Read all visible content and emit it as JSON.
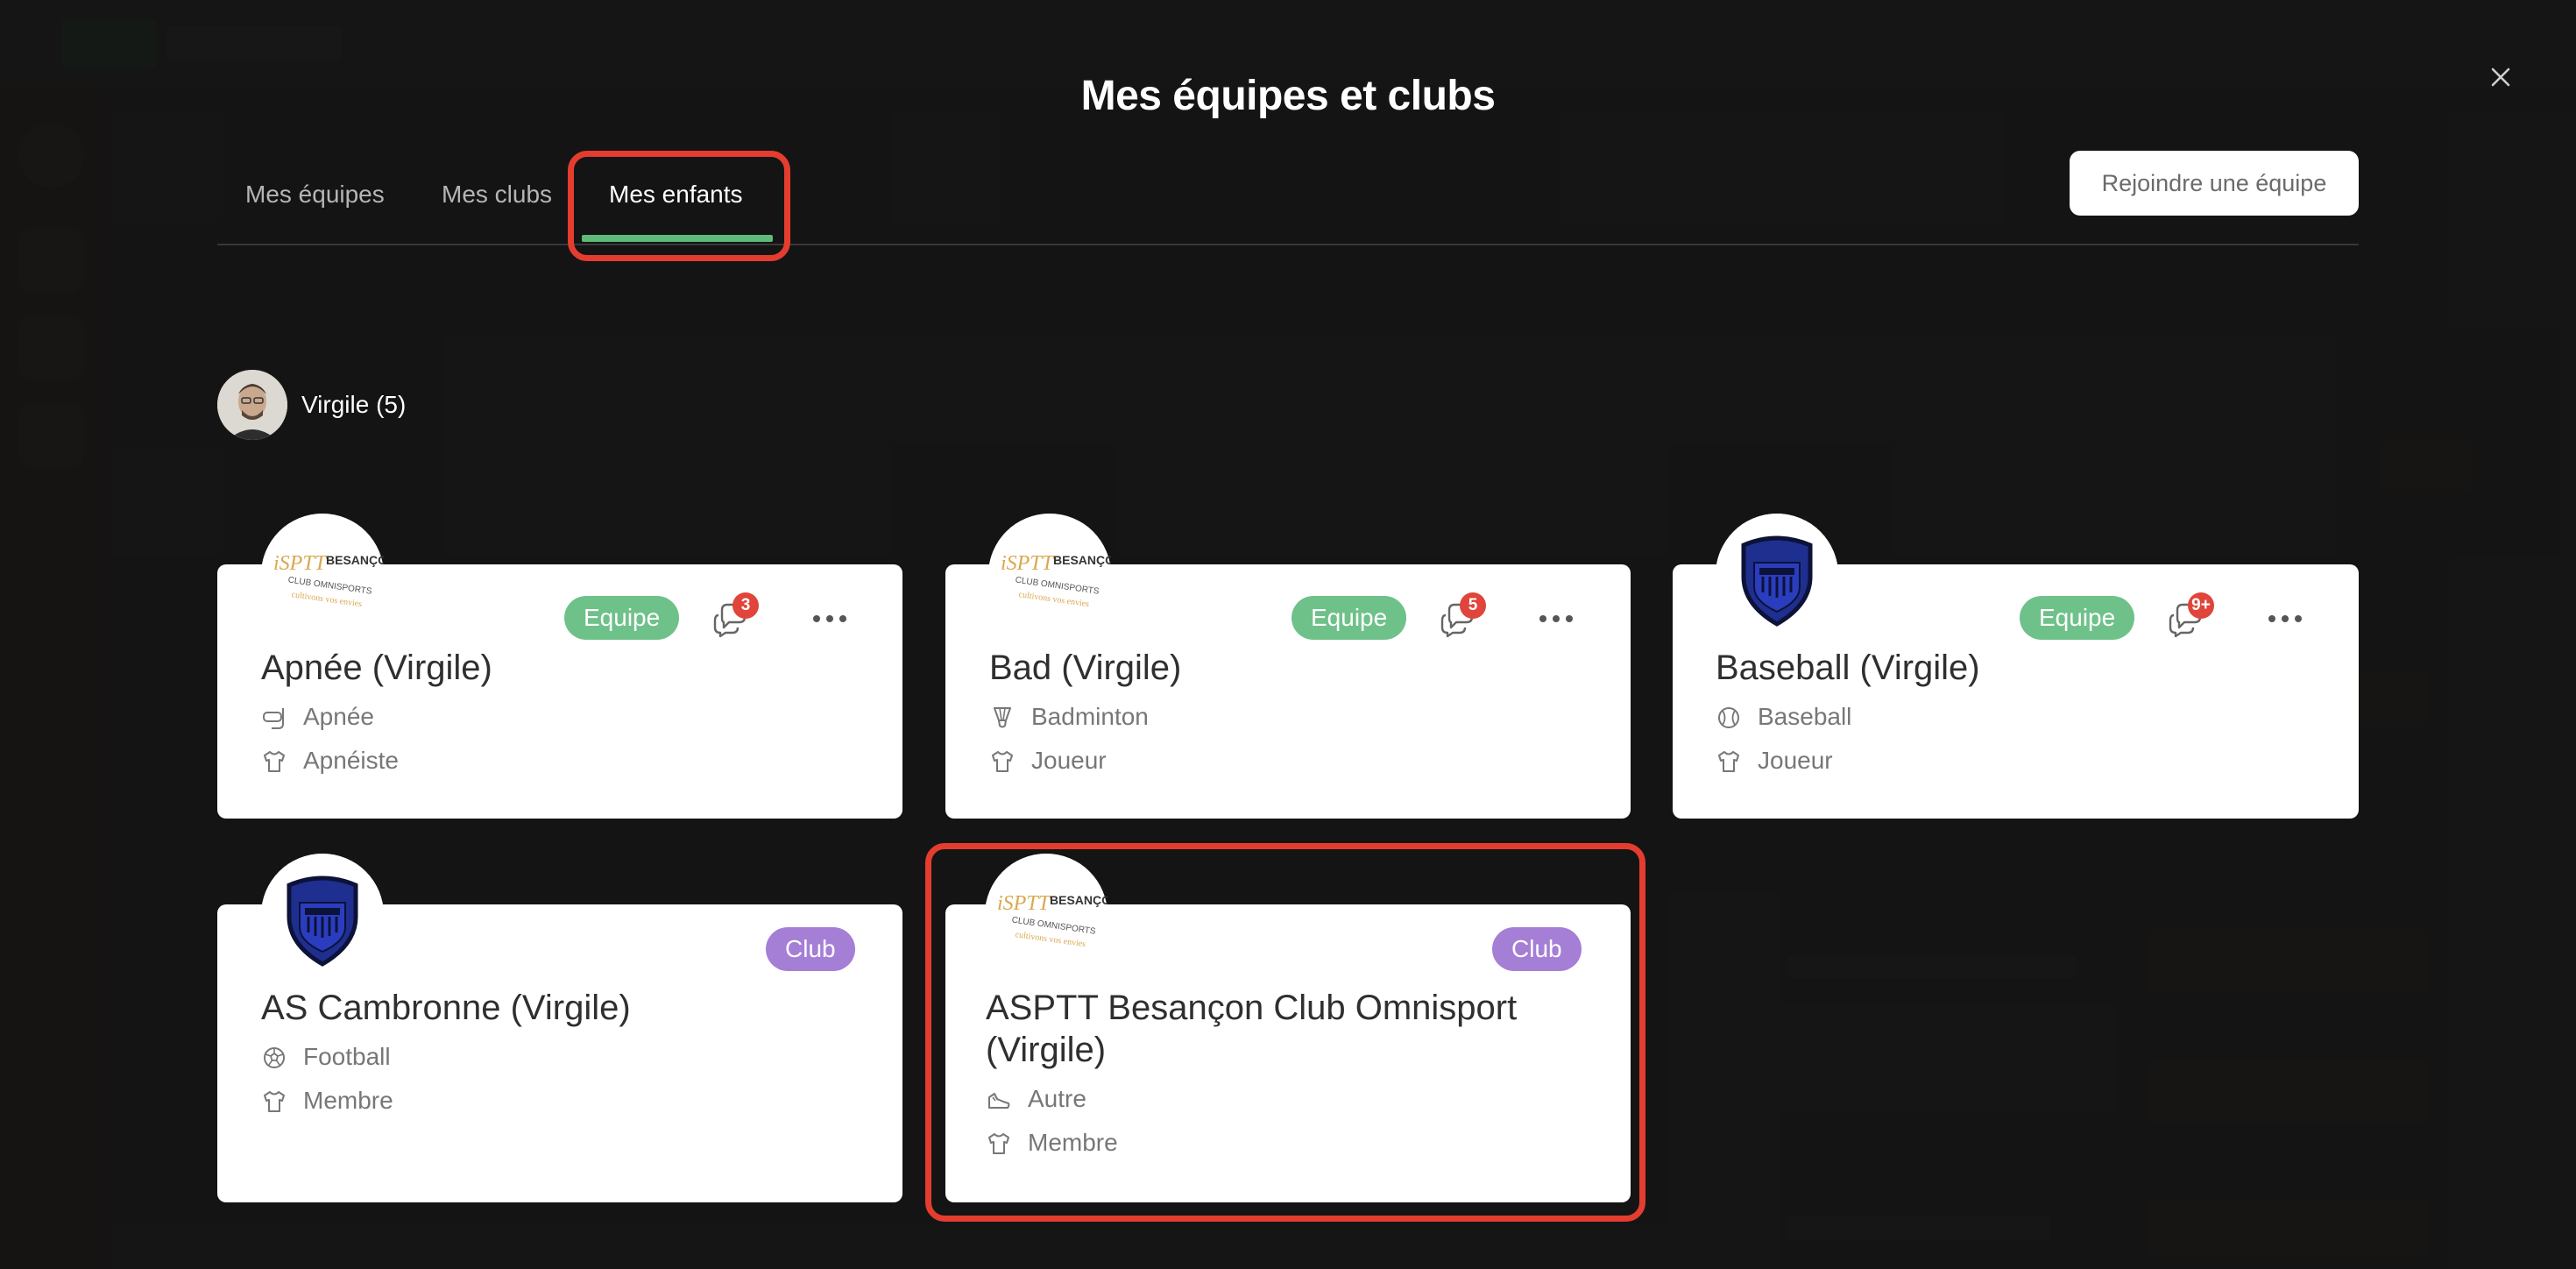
{
  "modal": {
    "title": "Mes équipes et clubs",
    "tabs": [
      {
        "label": "Mes équipes",
        "active": false
      },
      {
        "label": "Mes clubs",
        "active": false
      },
      {
        "label": "Mes enfants",
        "active": true
      }
    ],
    "join_button": "Rejoindre une équipe",
    "child": {
      "name": "Virgile (5)"
    },
    "cards": [
      {
        "title": "Apnée (Virgile)",
        "badge": "Equipe",
        "messages": "3",
        "sport": "Apnée",
        "role": "Apnéiste",
        "logo": "asptt-logo"
      },
      {
        "title": "Bad (Virgile)",
        "badge": "Equipe",
        "messages": "5",
        "sport": "Badminton",
        "role": "Joueur",
        "logo": "asptt-logo"
      },
      {
        "title": "Baseball (Virgile)",
        "badge": "Equipe",
        "messages": "9+",
        "sport": "Baseball",
        "role": "Joueur",
        "logo": "shield-logo"
      },
      {
        "title": "AS Cambronne (Virgile)",
        "badge": "Club",
        "sport": "Football",
        "role": "Membre",
        "logo": "shield-logo"
      },
      {
        "title": "ASPTT Besançon Club Omnisport (Virgile)",
        "badge": "Club",
        "sport": "Autre",
        "role": "Membre",
        "logo": "asptt-logo"
      }
    ]
  },
  "colors": {
    "equipe_badge": "#6fc18a",
    "club_badge": "#a57ed6",
    "tab_underline": "#5fb978",
    "highlight": "#e43d30",
    "notification": "#e0443a"
  }
}
